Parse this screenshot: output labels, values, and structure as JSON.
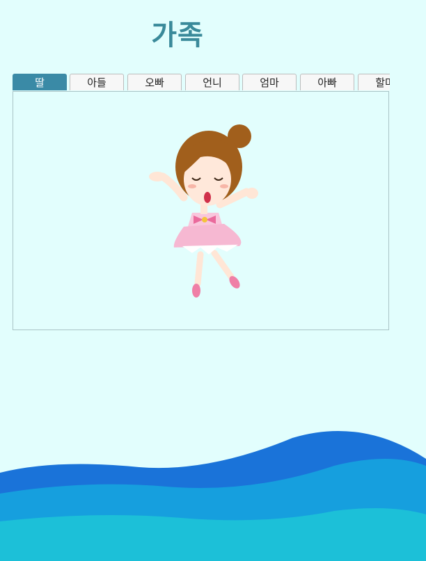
{
  "page": {
    "title": "가족"
  },
  "tabs": [
    {
      "label": "딸",
      "active": true
    },
    {
      "label": "아들",
      "active": false
    },
    {
      "label": "오빠",
      "active": false
    },
    {
      "label": "언니",
      "active": false
    },
    {
      "label": "엄마",
      "active": false
    },
    {
      "label": "아빠",
      "active": false
    },
    {
      "label": "할머",
      "active": false
    }
  ],
  "colors": {
    "background": "#e2fefd",
    "title": "#3a8a9a",
    "active_tab": "#3a8aa6",
    "wave_dark": "#1a73d9",
    "wave_mid": "#169fde",
    "wave_light": "#1cc0d8"
  },
  "illustration": {
    "icon": "ballerina-girl-icon"
  }
}
